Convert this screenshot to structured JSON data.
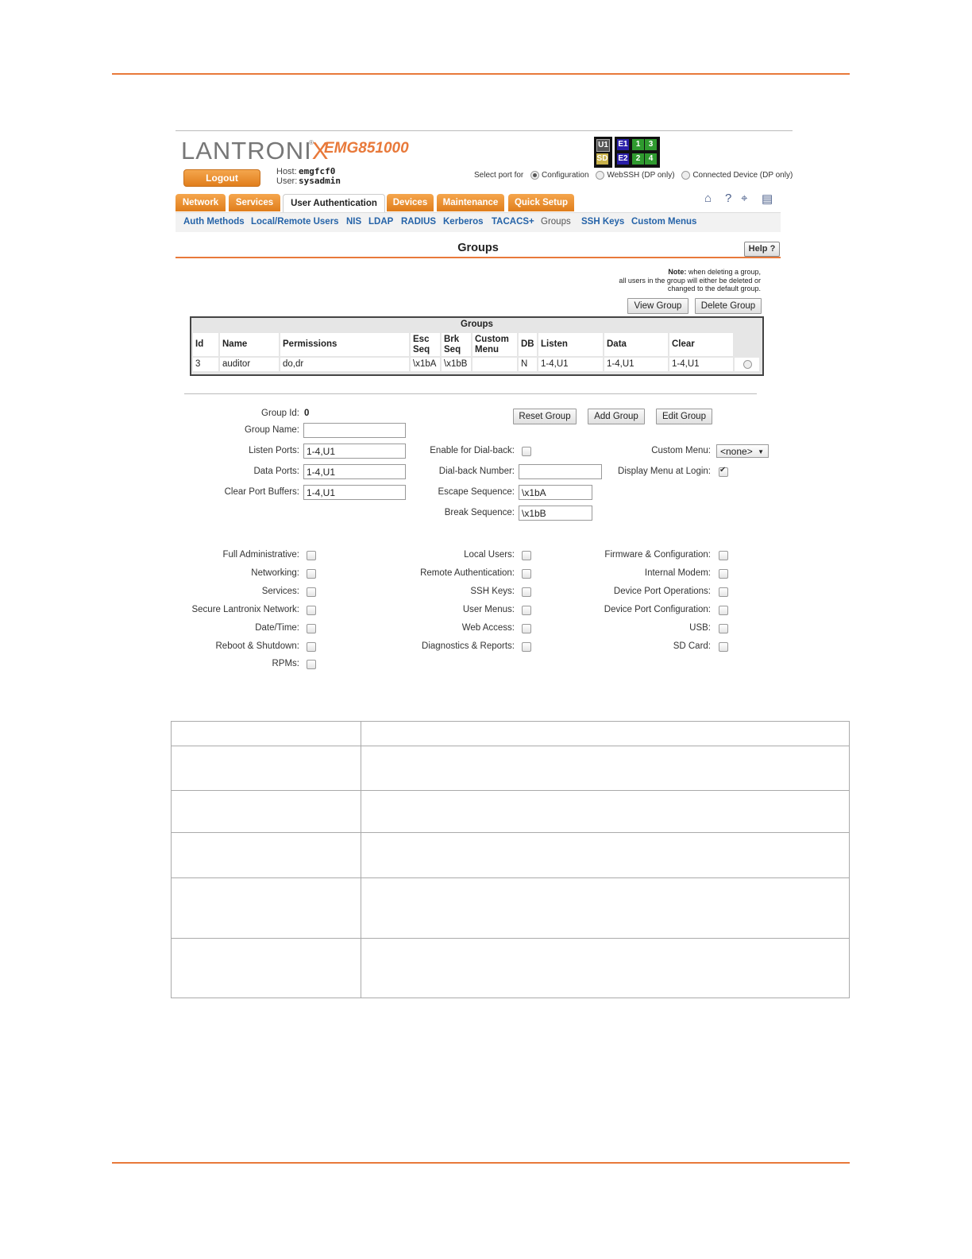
{
  "header": {
    "logo_text": "LANTRONIX",
    "model": "EMG851000",
    "logout_label": "Logout",
    "host_label": "Host:",
    "host_value": "emgfcf0",
    "user_label": "User:",
    "user_value": "sysadmin",
    "ports": {
      "u1": "U1",
      "sd": "SD",
      "e1": "E1",
      "e2": "E2",
      "p1": "1",
      "p2": "2",
      "p3": "3",
      "p4": "4"
    },
    "select_port_label": "Select port for",
    "select_options": [
      "Configuration",
      "WebSSH (DP only)",
      "Connected Device (DP only)"
    ],
    "selected_option": "Configuration"
  },
  "tabs": [
    "Network",
    "Services",
    "User Authentication",
    "Devices",
    "Maintenance",
    "Quick Setup"
  ],
  "active_tab": "User Authentication",
  "toolbar_icons": [
    "home-icon",
    "help-question-icon",
    "network-icon",
    "logout-panel-icon"
  ],
  "subnav": [
    "Auth Methods",
    "Local/Remote Users",
    "NIS",
    "LDAP",
    "RADIUS",
    "Kerberos",
    "TACACS+",
    "Groups",
    "SSH Keys",
    "Custom Menus"
  ],
  "current_subnav": "Groups",
  "page_title": "Groups",
  "help_label": "Help",
  "note": {
    "prefix": "Note:",
    "text1": " when deleting a group,",
    "text2": "all users in the group will either be deleted or",
    "text3": "changed to the default group."
  },
  "buttons": {
    "view_group": "View Group",
    "delete_group": "Delete Group",
    "reset_group": "Reset Group",
    "add_group": "Add Group",
    "edit_group": "Edit Group"
  },
  "groups_table": {
    "caption": "Groups",
    "headers": [
      "Id",
      "Name",
      "Permissions",
      "Esc Seq",
      "Brk Seq",
      "Custom Menu",
      "DB",
      "Listen",
      "Data",
      "Clear"
    ],
    "rows": [
      [
        "3",
        "auditor",
        "do,dr",
        "\\x1bA",
        "\\x1bB",
        "",
        "N",
        "1-4,U1",
        "1-4,U1",
        "1-4,U1"
      ]
    ]
  },
  "form": {
    "group_id_label": "Group Id:",
    "group_id_value": "0",
    "group_name_label": "Group Name:",
    "group_name_value": "",
    "listen_ports_label": "Listen Ports:",
    "listen_ports_value": "1-4,U1",
    "data_ports_label": "Data Ports:",
    "data_ports_value": "1-4,U1",
    "clear_port_buffers_label": "Clear Port Buffers:",
    "clear_port_buffers_value": "1-4,U1",
    "enable_dialback_label": "Enable for Dial-back:",
    "dialback_number_label": "Dial-back Number:",
    "dialback_number_value": "",
    "escape_sequence_label": "Escape Sequence:",
    "escape_sequence_value": "\\x1bA",
    "break_sequence_label": "Break Sequence:",
    "break_sequence_value": "\\x1bB",
    "custom_menu_label": "Custom Menu:",
    "custom_menu_value": "<none>",
    "display_menu_label": "Display Menu at Login:",
    "display_menu_checked": true
  },
  "permissions": {
    "col1": [
      "Full Administrative:",
      "Networking:",
      "Services:",
      "Secure Lantronix Network:",
      "Date/Time:",
      "Reboot & Shutdown:",
      "RPMs:"
    ],
    "col2": [
      "Local Users:",
      "Remote Authentication:",
      "SSH Keys:",
      "User Menus:",
      "Web Access:",
      "Diagnostics & Reports:"
    ],
    "col3": [
      "Firmware & Configuration:",
      "Internal Modem:",
      "Device Port Operations:",
      "Device Port Configuration:",
      "USB:",
      "SD Card:"
    ]
  },
  "colors": {
    "accent": "#e8793a",
    "tab": "#f0962f",
    "link": "#2563a8"
  }
}
